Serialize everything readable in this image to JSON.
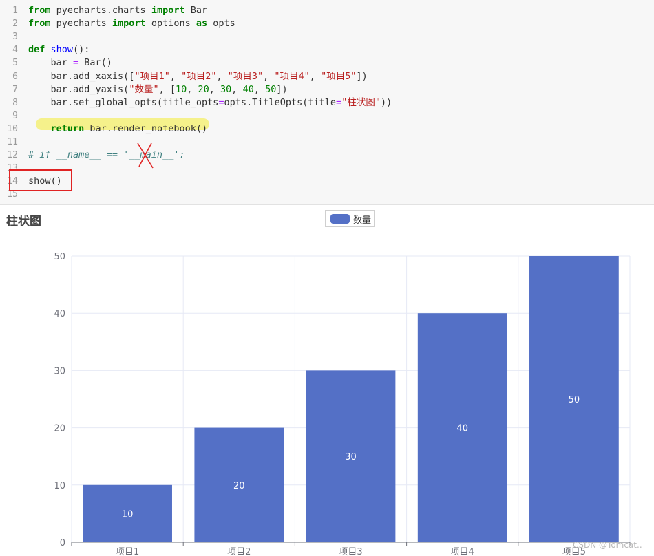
{
  "code": {
    "line_numbers": [
      "1",
      "2",
      "3",
      "4",
      "5",
      "6",
      "7",
      "8",
      "9",
      "10",
      "11",
      "12",
      "13",
      "14",
      "15"
    ],
    "lines": [
      [
        {
          "t": "from",
          "c": "kw"
        },
        {
          "t": " pyecharts.charts ",
          "c": ""
        },
        {
          "t": "import",
          "c": "kw"
        },
        {
          "t": " Bar",
          "c": ""
        }
      ],
      [
        {
          "t": "from",
          "c": "kw"
        },
        {
          "t": " pyecharts ",
          "c": ""
        },
        {
          "t": "import",
          "c": "kw"
        },
        {
          "t": " options ",
          "c": ""
        },
        {
          "t": "as",
          "c": "kw"
        },
        {
          "t": " opts",
          "c": ""
        }
      ],
      [],
      [
        {
          "t": "def",
          "c": "kw"
        },
        {
          "t": " ",
          "c": ""
        },
        {
          "t": "show",
          "c": "fn"
        },
        {
          "t": "():",
          "c": ""
        }
      ],
      [
        {
          "t": "    bar ",
          "c": ""
        },
        {
          "t": "=",
          "c": "op"
        },
        {
          "t": " Bar()",
          "c": ""
        }
      ],
      [
        {
          "t": "    bar.add_xaxis([",
          "c": ""
        },
        {
          "t": "\"项目1\"",
          "c": "str"
        },
        {
          "t": ", ",
          "c": ""
        },
        {
          "t": "\"项目2\"",
          "c": "str"
        },
        {
          "t": ", ",
          "c": ""
        },
        {
          "t": "\"项目3\"",
          "c": "str"
        },
        {
          "t": ", ",
          "c": ""
        },
        {
          "t": "\"项目4\"",
          "c": "str"
        },
        {
          "t": ", ",
          "c": ""
        },
        {
          "t": "\"项目5\"",
          "c": "str"
        },
        {
          "t": "])",
          "c": ""
        }
      ],
      [
        {
          "t": "    bar.add_yaxis(",
          "c": ""
        },
        {
          "t": "\"数量\"",
          "c": "str"
        },
        {
          "t": ", [",
          "c": ""
        },
        {
          "t": "10",
          "c": "num"
        },
        {
          "t": ", ",
          "c": ""
        },
        {
          "t": "20",
          "c": "num"
        },
        {
          "t": ", ",
          "c": ""
        },
        {
          "t": "30",
          "c": "num"
        },
        {
          "t": ", ",
          "c": ""
        },
        {
          "t": "40",
          "c": "num"
        },
        {
          "t": ", ",
          "c": ""
        },
        {
          "t": "50",
          "c": "num"
        },
        {
          "t": "])",
          "c": ""
        }
      ],
      [
        {
          "t": "    bar.set_global_opts(title_opts",
          "c": ""
        },
        {
          "t": "=",
          "c": "op"
        },
        {
          "t": "opts.TitleOpts(title",
          "c": ""
        },
        {
          "t": "=",
          "c": "op"
        },
        {
          "t": "\"柱状图\"",
          "c": "str"
        },
        {
          "t": "))",
          "c": ""
        }
      ],
      [],
      [
        {
          "t": "    ",
          "c": ""
        },
        {
          "t": "return",
          "c": "kw"
        },
        {
          "t": " bar.render_notebook()",
          "c": ""
        }
      ],
      [],
      [
        {
          "t": "# if __name__ == '__main__':",
          "c": "cmt"
        }
      ],
      [],
      [
        {
          "t": "show()",
          "c": ""
        }
      ],
      []
    ]
  },
  "chart": {
    "title": "柱状图",
    "legend": "数量",
    "bar_color": "#5470c6"
  },
  "chart_data": {
    "type": "bar",
    "title": "柱状图",
    "categories": [
      "项目1",
      "项目2",
      "项目3",
      "项目4",
      "项目5"
    ],
    "series": [
      {
        "name": "数量",
        "values": [
          10,
          20,
          30,
          40,
          50
        ]
      }
    ],
    "y_ticks": [
      "0",
      "10",
      "20",
      "30",
      "40",
      "50"
    ],
    "ylim": [
      0,
      50
    ],
    "grid": true,
    "legend_position": "top-center",
    "data_labels": "inside"
  },
  "watermark": "CSDN @Tomcat.."
}
